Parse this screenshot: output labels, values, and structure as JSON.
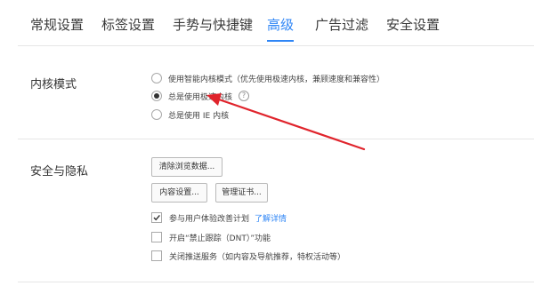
{
  "tabs": [
    {
      "label": "常规设置",
      "active": false
    },
    {
      "label": "标签设置",
      "active": false
    },
    {
      "label": "手势与快捷键",
      "active": false
    },
    {
      "label": "高级",
      "active": true
    },
    {
      "label": "广告过滤",
      "active": false
    },
    {
      "label": "安全设置",
      "active": false
    }
  ],
  "kernel": {
    "title": "内核模式",
    "options": [
      {
        "label": "使用智能内核模式（优先使用极速内核，兼顾速度和兼容性）",
        "checked": false
      },
      {
        "label": "总是使用极速内核",
        "checked": true
      },
      {
        "label": "总是使用 IE 内核",
        "checked": false
      }
    ],
    "help_glyph": "?"
  },
  "privacy": {
    "title": "安全与隐私",
    "clear_button": "清除浏览数据...",
    "content_button": "内容设置...",
    "cert_button": "管理证书...",
    "checks": [
      {
        "label": "参与用户体验改善计划",
        "checked": true,
        "link": "了解详情"
      },
      {
        "label": "开启“禁止跟踪（DNT）”功能",
        "checked": false
      },
      {
        "label": "关闭推送服务（如内容及导航推荐，特权活动等）",
        "checked": false
      }
    ]
  },
  "colors": {
    "accent": "#2f86f6",
    "arrow": "#e0242c"
  },
  "icons": {
    "help": "question-circle-icon",
    "check": "checkmark-icon",
    "arrow": "red-annotation-arrow-icon"
  }
}
